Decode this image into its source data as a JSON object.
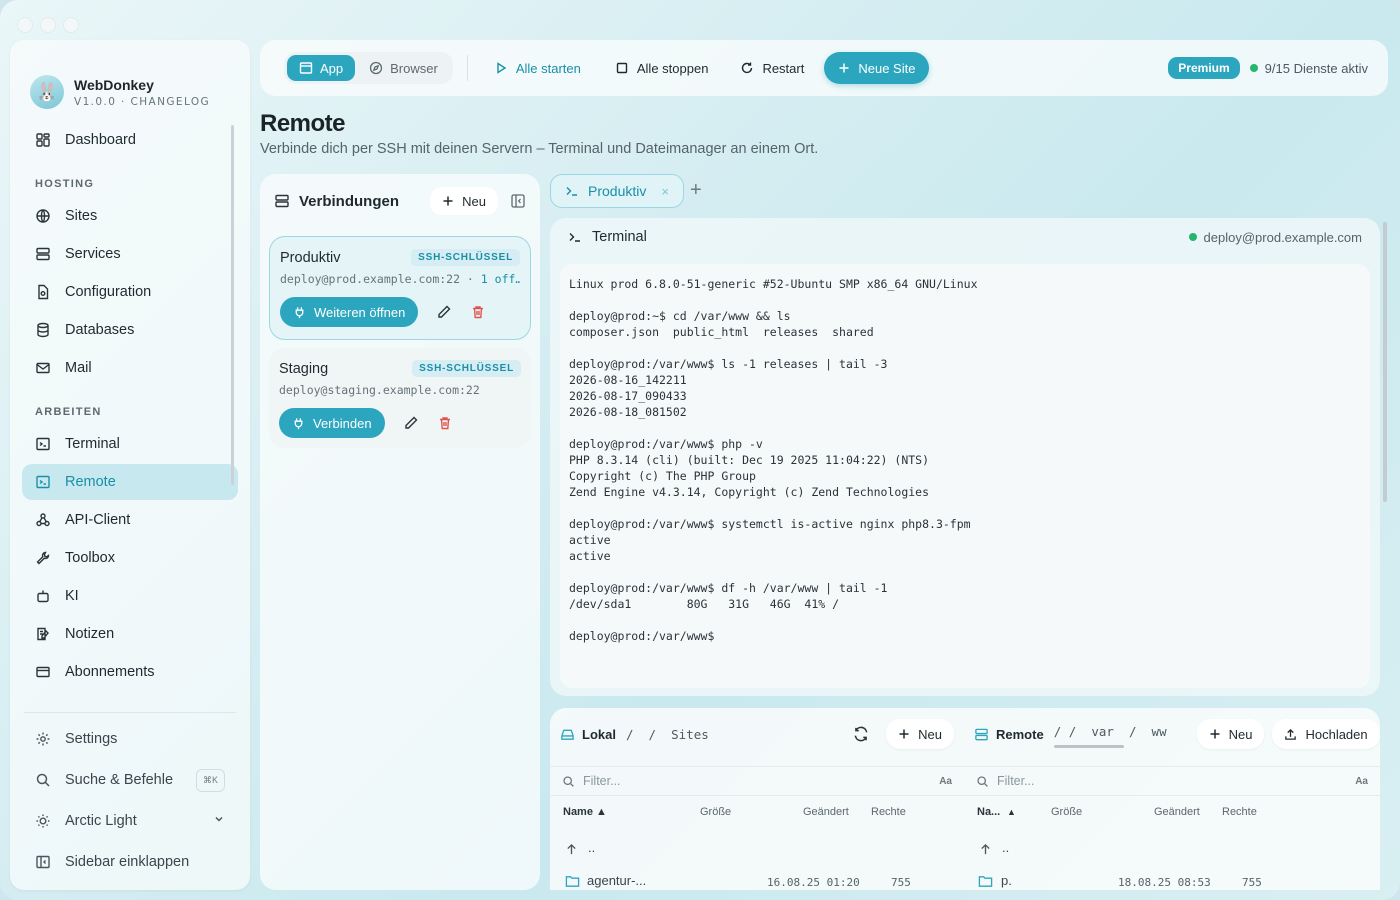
{
  "brand": {
    "name": "WebDonkey",
    "sub": "V1.0.0 · CHANGELOG",
    "logo_icon": "🐰"
  },
  "nav": {
    "dashboard": "Dashboard",
    "hosting_label": "HOSTING",
    "sites": "Sites",
    "services": "Services",
    "configuration": "Configuration",
    "databases": "Databases",
    "mail": "Mail",
    "arbeiten_label": "ARBEITEN",
    "terminal": "Terminal",
    "remote": "Remote",
    "api_client": "API-Client",
    "toolbox": "Toolbox",
    "ki": "KI",
    "notizen": "Notizen",
    "abonnements": "Abonnements"
  },
  "sidebar_bottom": {
    "settings": "Settings",
    "search": "Suche & Befehle",
    "search_kbd": "⌘K",
    "theme": "Arctic Light",
    "collapse": "Sidebar einklappen"
  },
  "toolbar": {
    "app": "App",
    "browser": "Browser",
    "start_all": "Alle starten",
    "stop_all": "Alle stoppen",
    "restart": "Restart",
    "new_site": "Neue Site",
    "premium": "Premium",
    "services_status": "9/15 Dienste aktiv"
  },
  "colors": {
    "accent": "#2ca6bf",
    "accent_text": "#1a8fa8",
    "status_ok": "#27b46d",
    "danger": "#e2534b"
  },
  "page": {
    "title": "Remote",
    "subtitle": "Verbinde dich per SSH mit deinen Servern – Terminal und Dateimanager an einem Ort."
  },
  "connections": {
    "title": "Verbindungen",
    "new_label": "Neu",
    "items": [
      {
        "name": "Produktiv",
        "badge": "SSH-SCHLÜSSEL",
        "host": "deploy@prod.example.com:22 · ",
        "extra": "1 off…",
        "action": "Weiteren öffnen"
      },
      {
        "name": "Staging",
        "badge": "SSH-SCHLÜSSEL",
        "host": "deploy@staging.example.com:22",
        "extra": "",
        "action": "Verbinden"
      }
    ]
  },
  "tabs": {
    "active": "Produktiv",
    "close": "×",
    "add": "+"
  },
  "terminal": {
    "title": "Terminal",
    "host": "deploy@prod.example.com",
    "output": "Linux prod 6.8.0-51-generic #52-Ubuntu SMP x86_64 GNU/Linux\n\ndeploy@prod:~$ cd /var/www && ls\ncomposer.json  public_html  releases  shared\n\ndeploy@prod:/var/www$ ls -1 releases | tail -3\n2026-08-16_142211\n2026-08-17_090433\n2026-08-18_081502\n\ndeploy@prod:/var/www$ php -v\nPHP 8.3.14 (cli) (built: Dec 19 2025 11:04:22) (NTS)\nCopyright (c) The PHP Group\nZend Engine v4.3.14, Copyright (c) Zend Technologies\n\ndeploy@prod:/var/www$ systemctl is-active nginx php8.3-fpm\nactive\nactive\n\ndeploy@prod:/var/www$ df -h /var/www | tail -1\n/dev/sda1        80G   31G   46G  41% /\n\ndeploy@prod:/var/www$"
  },
  "files": {
    "local": {
      "label": "Lokal",
      "path_root": "/",
      "path": "Sites",
      "new_label": "Neu",
      "filter_placeholder": "Filter...",
      "aa": "Aa",
      "cols": {
        "name": "Name ▲",
        "size": "Größe",
        "modified": "Geändert",
        "perms": "Rechte"
      },
      "up": "..",
      "rows": [
        {
          "name": "agentur-...",
          "modified": "16.08.25 01:20",
          "perms": "755"
        }
      ]
    },
    "remote": {
      "label": "Remote",
      "path_root": "/",
      "path1": "var",
      "path2": "ww",
      "new_label": "Neu",
      "upload_label": "Hochladen",
      "filter_placeholder": "Filter...",
      "aa": "Aa",
      "cols": {
        "name": "Na...",
        "sort": "▲",
        "size": "Größe",
        "modified": "Geändert",
        "perms": "Rechte"
      },
      "up": "..",
      "rows": [
        {
          "name": "p.",
          "modified": "18.08.25 08:53",
          "perms": "755"
        }
      ]
    }
  }
}
